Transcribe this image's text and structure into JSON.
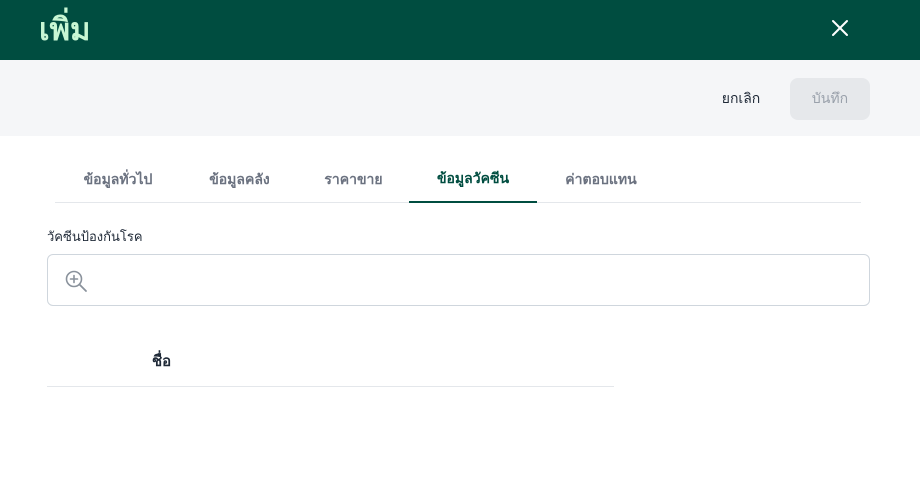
{
  "header": {
    "title": "เพิ่ม",
    "close_icon": "close-icon",
    "background_color": "#004d40",
    "title_color": "#c8f7d4"
  },
  "actions": {
    "cancel_label": "ยกเลิก",
    "save_label": "บันทึก"
  },
  "tabs": [
    {
      "label": "ข้อมูลทั่วไป",
      "active": false
    },
    {
      "label": "ข้อมูลคลัง",
      "active": false
    },
    {
      "label": "ราคาขาย",
      "active": false
    },
    {
      "label": "ข้อมูลวัคซีน",
      "active": true
    },
    {
      "label": "ค่าตอบแทน",
      "active": false
    }
  ],
  "vaccine": {
    "field_label": "วัคซีนป้องกันโรค",
    "search_icon": "zoom-in-icon",
    "search_value": "",
    "table": {
      "columns": [
        "ชื่อ"
      ]
    }
  }
}
